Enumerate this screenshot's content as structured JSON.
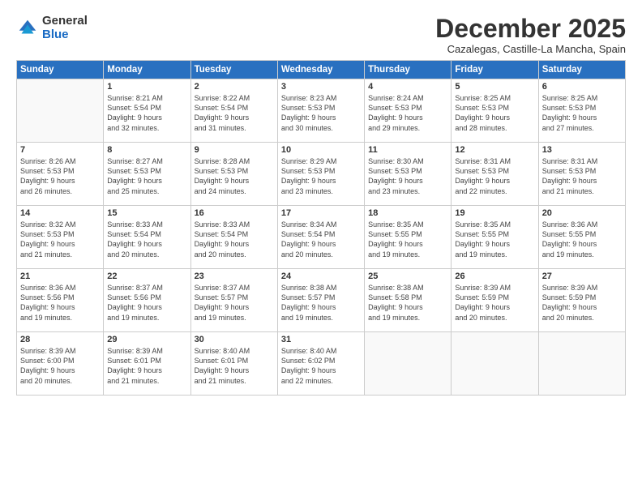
{
  "logo": {
    "general": "General",
    "blue": "Blue"
  },
  "title": "December 2025",
  "subtitle": "Cazalegas, Castille-La Mancha, Spain",
  "days_header": [
    "Sunday",
    "Monday",
    "Tuesday",
    "Wednesday",
    "Thursday",
    "Friday",
    "Saturday"
  ],
  "weeks": [
    [
      {
        "day": "",
        "info": ""
      },
      {
        "day": "1",
        "info": "Sunrise: 8:21 AM\nSunset: 5:54 PM\nDaylight: 9 hours\nand 32 minutes."
      },
      {
        "day": "2",
        "info": "Sunrise: 8:22 AM\nSunset: 5:54 PM\nDaylight: 9 hours\nand 31 minutes."
      },
      {
        "day": "3",
        "info": "Sunrise: 8:23 AM\nSunset: 5:53 PM\nDaylight: 9 hours\nand 30 minutes."
      },
      {
        "day": "4",
        "info": "Sunrise: 8:24 AM\nSunset: 5:53 PM\nDaylight: 9 hours\nand 29 minutes."
      },
      {
        "day": "5",
        "info": "Sunrise: 8:25 AM\nSunset: 5:53 PM\nDaylight: 9 hours\nand 28 minutes."
      },
      {
        "day": "6",
        "info": "Sunrise: 8:25 AM\nSunset: 5:53 PM\nDaylight: 9 hours\nand 27 minutes."
      }
    ],
    [
      {
        "day": "7",
        "info": ""
      },
      {
        "day": "8",
        "info": "Sunrise: 8:27 AM\nSunset: 5:53 PM\nDaylight: 9 hours\nand 25 minutes."
      },
      {
        "day": "9",
        "info": "Sunrise: 8:28 AM\nSunset: 5:53 PM\nDaylight: 9 hours\nand 24 minutes."
      },
      {
        "day": "10",
        "info": "Sunrise: 8:29 AM\nSunset: 5:53 PM\nDaylight: 9 hours\nand 23 minutes."
      },
      {
        "day": "11",
        "info": "Sunrise: 8:30 AM\nSunset: 5:53 PM\nDaylight: 9 hours\nand 23 minutes."
      },
      {
        "day": "12",
        "info": "Sunrise: 8:31 AM\nSunset: 5:53 PM\nDaylight: 9 hours\nand 22 minutes."
      },
      {
        "day": "13",
        "info": "Sunrise: 8:31 AM\nSunset: 5:53 PM\nDaylight: 9 hours\nand 21 minutes."
      }
    ],
    [
      {
        "day": "14",
        "info": ""
      },
      {
        "day": "15",
        "info": "Sunrise: 8:33 AM\nSunset: 5:54 PM\nDaylight: 9 hours\nand 20 minutes."
      },
      {
        "day": "16",
        "info": "Sunrise: 8:33 AM\nSunset: 5:54 PM\nDaylight: 9 hours\nand 20 minutes."
      },
      {
        "day": "17",
        "info": "Sunrise: 8:34 AM\nSunset: 5:54 PM\nDaylight: 9 hours\nand 20 minutes."
      },
      {
        "day": "18",
        "info": "Sunrise: 8:35 AM\nSunset: 5:55 PM\nDaylight: 9 hours\nand 19 minutes."
      },
      {
        "day": "19",
        "info": "Sunrise: 8:35 AM\nSunset: 5:55 PM\nDaylight: 9 hours\nand 19 minutes."
      },
      {
        "day": "20",
        "info": "Sunrise: 8:36 AM\nSunset: 5:55 PM\nDaylight: 9 hours\nand 19 minutes."
      }
    ],
    [
      {
        "day": "21",
        "info": "Sunrise: 8:36 AM\nSunset: 5:56 PM\nDaylight: 9 hours\nand 19 minutes."
      },
      {
        "day": "22",
        "info": "Sunrise: 8:37 AM\nSunset: 5:56 PM\nDaylight: 9 hours\nand 19 minutes."
      },
      {
        "day": "23",
        "info": "Sunrise: 8:37 AM\nSunset: 5:57 PM\nDaylight: 9 hours\nand 19 minutes."
      },
      {
        "day": "24",
        "info": "Sunrise: 8:38 AM\nSunset: 5:57 PM\nDaylight: 9 hours\nand 19 minutes."
      },
      {
        "day": "25",
        "info": "Sunrise: 8:38 AM\nSunset: 5:58 PM\nDaylight: 9 hours\nand 19 minutes."
      },
      {
        "day": "26",
        "info": "Sunrise: 8:39 AM\nSunset: 5:59 PM\nDaylight: 9 hours\nand 20 minutes."
      },
      {
        "day": "27",
        "info": "Sunrise: 8:39 AM\nSunset: 5:59 PM\nDaylight: 9 hours\nand 20 minutes."
      }
    ],
    [
      {
        "day": "28",
        "info": "Sunrise: 8:39 AM\nSunset: 6:00 PM\nDaylight: 9 hours\nand 20 minutes."
      },
      {
        "day": "29",
        "info": "Sunrise: 8:39 AM\nSunset: 6:01 PM\nDaylight: 9 hours\nand 21 minutes."
      },
      {
        "day": "30",
        "info": "Sunrise: 8:40 AM\nSunset: 6:01 PM\nDaylight: 9 hours\nand 21 minutes."
      },
      {
        "day": "31",
        "info": "Sunrise: 8:40 AM\nSunset: 6:02 PM\nDaylight: 9 hours\nand 22 minutes."
      },
      {
        "day": "",
        "info": ""
      },
      {
        "day": "",
        "info": ""
      },
      {
        "day": "",
        "info": ""
      }
    ]
  ],
  "week2_sun": "Sunrise: 8:26 AM\nSunset: 5:53 PM\nDaylight: 9 hours\nand 26 minutes.",
  "week3_sun": "Sunrise: 8:32 AM\nSunset: 5:53 PM\nDaylight: 9 hours\nand 21 minutes."
}
